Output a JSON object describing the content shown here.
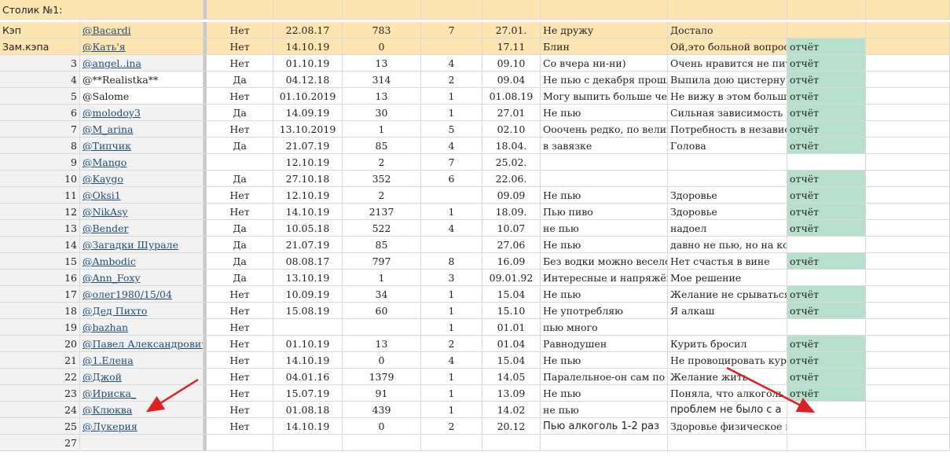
{
  "sheet_title": "Столик №1:",
  "colors": {
    "header_yellow": "#fce5b1",
    "report_green": "#b7e1cd",
    "arrow_red": "#e02020",
    "link_blue": "#1f4e79"
  },
  "rows": [
    {
      "num": "Кэп",
      "handle": "@Bacardi",
      "drinks": "Нет",
      "date": "22.08.17",
      "days": "783",
      "c5": "7",
      "c6": "27.01.",
      "note1": "Не дружу",
      "note2": "Достало",
      "report": "",
      "style": "yellow",
      "link": true
    },
    {
      "num": "Зам.кэпа",
      "handle": "@Кать'я",
      "drinks": "Нет",
      "date": "14.10.19",
      "days": "0",
      "c5": "",
      "c6": "17.11",
      "note1": "Блин",
      "note2": "Ой,это больной вопрос",
      "report": "отчёт",
      "style": "yellow",
      "link": true
    },
    {
      "num": "3",
      "handle": "@angel..ina",
      "drinks": "Нет",
      "date": "01.10.19",
      "days": "13",
      "c5": "4",
      "c6": "09.10",
      "note1": "Со вчера ни-ни)",
      "note2": "Очень нравится не пить",
      "report": "отчёт",
      "link": true
    },
    {
      "num": "4",
      "handle": "@**Realistka**",
      "drinks": "Да",
      "date": "04.12.18",
      "days": "314",
      "c5": "2",
      "c6": "09.04",
      "note1": "Не пью с декабря прошлого",
      "note2": "Выпила дою цистерну))",
      "report": "отчёт",
      "link": false
    },
    {
      "num": "5",
      "handle": "@Salome",
      "drinks": "Нет",
      "date": "01.10.2019",
      "days": "13",
      "c5": "1",
      "c6": "01.08.19",
      "note1": "Могу выпить больше чем",
      "note2": "Не вижу в этом больше",
      "report": "отчёт",
      "link": false
    },
    {
      "num": "6",
      "handle": "@molodoy3",
      "drinks": "Да",
      "date": "14.09.19",
      "days": "30",
      "c5": "1",
      "c6": "27.01",
      "note1": "Не пью",
      "note2": "Сильная зависимость",
      "report": "отчёт",
      "link": true
    },
    {
      "num": "7",
      "handle": "@M_arina",
      "drinks": "Нет",
      "date": "13.10.2019",
      "days": "1",
      "c5": "5",
      "c6": "02.10",
      "note1": "Ооочень редко, по великим",
      "note2": "Потребность в независимости",
      "report": "отчёт",
      "link": true
    },
    {
      "num": "8",
      "handle": "@Типчик",
      "drinks": "Да",
      "date": "21.07.19",
      "days": "85",
      "c5": "4",
      "c6": "18.04.",
      "note1": "в завязке",
      "note2": "Голова",
      "report": "отчёт",
      "link": true
    },
    {
      "num": "9",
      "handle": "@Mango",
      "drinks": "",
      "date": "12.10.19",
      "days": "2",
      "c5": "7",
      "c6": "25.02.",
      "note1": "",
      "note2": "",
      "report": "",
      "link": true
    },
    {
      "num": "10",
      "handle": "@Kaygo",
      "drinks": "Да",
      "date": "27.10.18",
      "days": "352",
      "c5": "6",
      "c6": "22.06.",
      "note1": "",
      "note2": "",
      "report": "отчёт",
      "link": true
    },
    {
      "num": "11",
      "handle": "@Oksi1",
      "drinks": "Нет",
      "date": "12.10.19",
      "days": "2",
      "c5": "",
      "c6": "09.09",
      "note1": "Не пью",
      "note2": "Здоровье",
      "report": "отчёт",
      "link": true
    },
    {
      "num": "12",
      "handle": "@NikAsy",
      "drinks": "Нет",
      "date": "14.10.19",
      "days": "2137",
      "c5": "1",
      "c6": "18.09.",
      "note1": "Пью пиво",
      "note2": "Здоровье",
      "report": "отчёт",
      "link": true
    },
    {
      "num": "13",
      "handle": "@Bender",
      "drinks": "Да",
      "date": "10.05.18",
      "days": "522",
      "c5": "4",
      "c6": "10.07",
      "note1": "не пью",
      "note2": "надоел",
      "report": "отчёт",
      "link": true
    },
    {
      "num": "14",
      "handle": "@Загадки Шурале",
      "drinks": "Да",
      "date": "21.07.19",
      "days": "85",
      "c5": "",
      "c6": "27.06",
      "note1": "Не пью",
      "note2": "давно не пью, но на конец",
      "report": "",
      "link": true
    },
    {
      "num": "15",
      "handle": "@Ambodic",
      "drinks": "Да",
      "date": "08.08.17",
      "days": "797",
      "c5": "8",
      "c6": "16.09",
      "note1": "Без водки можно весело п",
      "note2": "Нет счастья в вине",
      "report": "отчёт",
      "link": true
    },
    {
      "num": "16",
      "handle": "@Ann_Foxy",
      "drinks": "Да",
      "date": "13.10.19",
      "days": "1",
      "c5": "3",
      "c6": "09.01.92",
      "note1": "Интересные и напряжённ",
      "note2": "Мое решение",
      "report": "",
      "link": true
    },
    {
      "num": "17",
      "handle": "@олег1980/15/04",
      "drinks": "Нет",
      "date": "10.09.19",
      "days": "34",
      "c5": "1",
      "c6": "15.04",
      "note1": "Не пью",
      "note2": "Желание не срываться в",
      "report": "отчёт",
      "link": true
    },
    {
      "num": "18",
      "handle": "@Дед Пихто",
      "drinks": "Нет",
      "date": "15.08.19",
      "days": "60",
      "c5": "1",
      "c6": "15.10",
      "note1": "Не употребляю",
      "note2": "Я алкаш",
      "report": "отчёт",
      "link": true
    },
    {
      "num": "19",
      "handle": "@bazhan",
      "drinks": "Нет",
      "date": "",
      "days": "",
      "c5": "1",
      "c6": "01.01",
      "note1": "пью много",
      "note2": "",
      "report": "",
      "link": true
    },
    {
      "num": "20",
      "handle": "@Павел Александрович",
      "drinks": "Нет",
      "date": "01.10.19",
      "days": "13",
      "c5": "2",
      "c6": "01.04",
      "note1": "Равнодушен",
      "note2": "Курить бросил",
      "report": "отчёт",
      "link": true
    },
    {
      "num": "21",
      "handle": "@1.Елена",
      "drinks": "Нет",
      "date": "14.10.19",
      "days": "0",
      "c5": "4",
      "c6": "15.04",
      "note1": "Не пью",
      "note2": "Не провоцировать куре",
      "report": "отчёт",
      "link": true
    },
    {
      "num": "22",
      "handle": "@Джой",
      "drinks": "Нет",
      "date": "04.01.16",
      "days": "1379",
      "c5": "1",
      "c6": "14.05",
      "note1": "Паралельное-он сам по се",
      "note2": "Желание жить.",
      "report": "отчёт",
      "link": true
    },
    {
      "num": "23",
      "handle": "@Ириска_",
      "drinks": "Нет",
      "date": "15.07.19",
      "days": "91",
      "c5": "1",
      "c6": "13.09",
      "note1": "Не пью",
      "note2": "Поняла, что алкоголь ме",
      "report": "отчёт",
      "link": true
    },
    {
      "num": "24",
      "handle": "@Клюква",
      "drinks": "Нет",
      "date": "01.08.18",
      "days": "439",
      "c5": "1",
      "c6": "14.02",
      "note1": "не пью",
      "note2": "проблем не было с а",
      "report": "",
      "link": true,
      "big2": true
    },
    {
      "num": "25",
      "handle": "@Лукерия",
      "drinks": "Нет",
      "date": "14.10.19",
      "days": "0",
      "c5": "2",
      "c6": "20.12",
      "note1": "Пью алкоголь 1-2 раз",
      "note2": "Здоровье физическое и з",
      "report": "",
      "link": true,
      "big1": true
    },
    {
      "num": "27",
      "handle": "",
      "drinks": "",
      "date": "",
      "days": "",
      "c5": "",
      "c6": "",
      "note1": "",
      "note2": "",
      "report": "",
      "link": false
    }
  ]
}
